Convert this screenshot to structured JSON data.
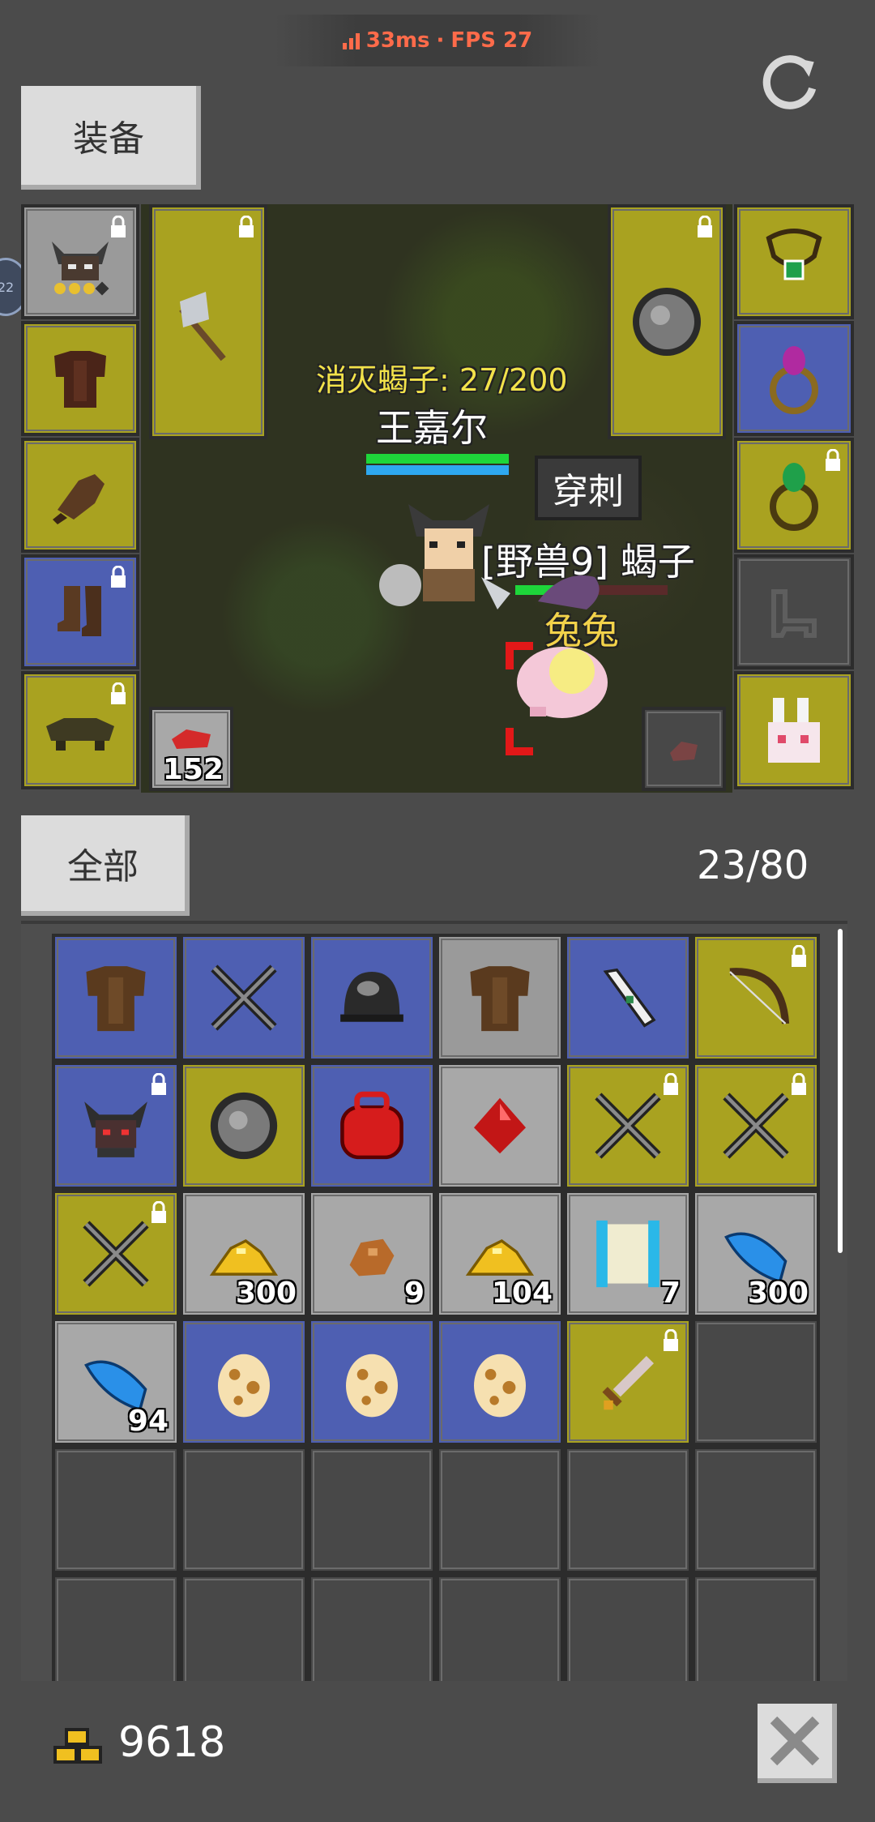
{
  "status": {
    "ping": "33ms",
    "separator": "·",
    "fps": "FPS 27"
  },
  "tabs": {
    "equipment": "装备",
    "all": "全部"
  },
  "inventory": {
    "count": "23/80"
  },
  "scene": {
    "quest": "消灭蝎子: 27/200",
    "player_name": "王嘉尔",
    "skill_popup": "穿刺",
    "monster_name": "[野兽9] 蝎子",
    "pet_name": "兔兔",
    "side_badge": "22"
  },
  "equipment": {
    "potion_qty": "152"
  },
  "inventory_items": [
    {
      "icon": "armor-icon",
      "bg": "blue",
      "qty": "",
      "locked": false
    },
    {
      "icon": "crossed-swords-icon",
      "bg": "blue",
      "qty": "",
      "locked": false
    },
    {
      "icon": "helmet-icon",
      "bg": "blue",
      "qty": "",
      "locked": false
    },
    {
      "icon": "armor-icon",
      "bg": "grey",
      "qty": "",
      "locked": false
    },
    {
      "icon": "boomerang-icon",
      "bg": "blue",
      "qty": "",
      "locked": false
    },
    {
      "icon": "bow-icon",
      "bg": "yellow",
      "qty": "",
      "locked": true
    },
    {
      "icon": "horned-helmet-icon",
      "bg": "blue",
      "qty": "",
      "locked": true
    },
    {
      "icon": "shield-icon",
      "bg": "yellow",
      "qty": "",
      "locked": false
    },
    {
      "icon": "red-bag-icon",
      "bg": "blue",
      "qty": "",
      "locked": false
    },
    {
      "icon": "ruby-icon",
      "bg": "lightgrey",
      "qty": "",
      "locked": false
    },
    {
      "icon": "crossed-swords-icon",
      "bg": "yellow",
      "qty": "",
      "locked": true
    },
    {
      "icon": "crossed-swords-icon",
      "bg": "yellow",
      "qty": "",
      "locked": true
    },
    {
      "icon": "crossed-swords-icon",
      "bg": "yellow",
      "qty": "",
      "locked": true
    },
    {
      "icon": "gold-pile-icon",
      "bg": "lightgrey",
      "qty": "300",
      "locked": false
    },
    {
      "icon": "ore-icon",
      "bg": "lightgrey",
      "qty": "9",
      "locked": false
    },
    {
      "icon": "gold-pile-icon",
      "bg": "lightgrey",
      "qty": "104",
      "locked": false
    },
    {
      "icon": "scroll-icon",
      "bg": "lightgrey",
      "qty": "7",
      "locked": false
    },
    {
      "icon": "blue-feather-icon",
      "bg": "lightgrey",
      "qty": "300",
      "locked": false
    },
    {
      "icon": "blue-feather-icon",
      "bg": "lightgrey",
      "qty": "94",
      "locked": false
    },
    {
      "icon": "egg-icon",
      "bg": "blue",
      "qty": "",
      "locked": false
    },
    {
      "icon": "egg-icon",
      "bg": "blue",
      "qty": "",
      "locked": false
    },
    {
      "icon": "egg-icon",
      "bg": "blue",
      "qty": "",
      "locked": false
    },
    {
      "icon": "dagger-icon",
      "bg": "yellow",
      "qty": "",
      "locked": true
    }
  ],
  "gold": {
    "value": "9618"
  },
  "colors": {
    "yellow_slot": "#a9a220",
    "blue_slot": "#4e5fb2",
    "grey_slot": "#9a9a9a"
  }
}
